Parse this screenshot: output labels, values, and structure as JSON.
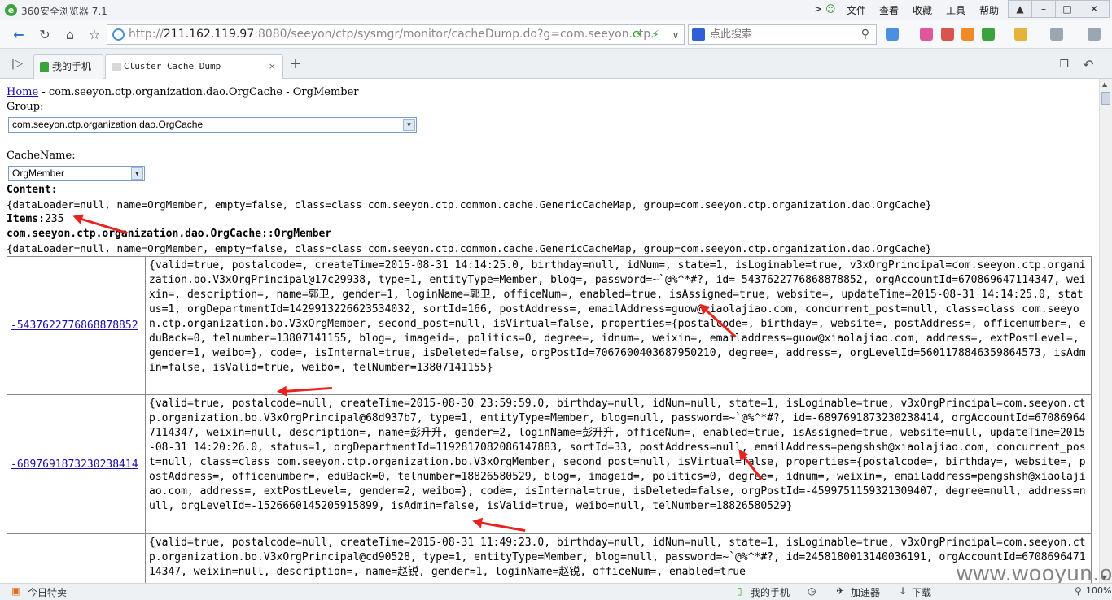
{
  "browser": {
    "title": "360安全浏览器 7.1",
    "menu": [
      "文件",
      "查看",
      "收藏",
      "工具",
      "帮助"
    ],
    "url_prefix": "http://",
    "url_host": "211.162.119.97",
    "url_rest": ":8080/seeyon/ctp/sysmgr/monitor/cacheDump.do?g=com.seeyon.ctp.",
    "search_placeholder": "点此搜索",
    "tabs": [
      {
        "label": "我的手机"
      },
      {
        "label": "Cluster Cache Dump",
        "active": true
      }
    ],
    "status_left": "今日特卖",
    "status_items": [
      "我的手机",
      "加速器",
      "下载",
      "100%"
    ]
  },
  "page": {
    "breadcrumb_home": "Home",
    "breadcrumb_rest": " - com.seeyon.ctp.organization.dao.OrgCache - OrgMember",
    "group_label": "Group:",
    "group_value": "com.seeyon.ctp.organization.dao.OrgCache",
    "cachename_label": "CacheName:",
    "cachename_value": "OrgMember",
    "content_label": "Content:",
    "content_desc": "{dataLoader=null, name=OrgMember, empty=false, class=class com.seeyon.ctp.common.cache.GenericCacheMap, group=com.seeyon.ctp.organization.dao.OrgCache}",
    "items_label": "Items:",
    "items_count": "235",
    "cache_heading": "com.seeyon.ctp.organization.dao.OrgCache::OrgMember",
    "cache_desc": "{dataLoader=null, name=OrgMember, empty=false, class=class com.seeyon.ctp.common.cache.GenericCacheMap, group=com.seeyon.ctp.organization.dao.OrgCache}",
    "rows": [
      {
        "key": "-5437622776868878852",
        "value": "{valid=true, postalcode=, createTime=2015-08-31 14:14:25.0, birthday=null, idNum=, state=1, isLoginable=true, v3xOrgPrincipal=com.seeyon.ctp.organization.bo.V3xOrgPrincipal@17c29938, type=1, entityType=Member, blog=, password=~`@%^*#?, id=-5437622776868878852, orgAccountId=670869647114347, weixin=, description=, name=郭卫, gender=1, loginName=郭卫, officeNum=, enabled=true, isAssigned=true, website=, updateTime=2015-08-31 14:14:25.0, status=1, orgDepartmentId=1429913226623534032, sortId=166, postAddress=, emailAddress=guow@xiaolajiao.com, concurrent_post=null, class=class com.seeyon.ctp.organization.bo.V3xOrgMember, second_post=null, isVirtual=false, properties={postalcode=, birthday=, website=, postAddress=, officenumber=, eduBack=0, telnumber=13807141155, blog=, imageid=, politics=0, degree=, idnum=, weixin=, emailaddress=guow@xiaolajiao.com, address=, extPostLevel=, gender=1, weibo=}, code=, isInternal=true, isDeleted=false, orgPostId=7067600403687950210, degree=, address=, orgLevelId=5601178846359864573, isAdmin=false, isValid=true, weibo=, telNumber=13807141155}"
      },
      {
        "key": "-6897691873230238414",
        "value": "{valid=true, postalcode=null, createTime=2015-08-30 23:59:59.0, birthday=null, idNum=null, state=1, isLoginable=true, v3xOrgPrincipal=com.seeyon.ctp.organization.bo.V3xOrgPrincipal@68d937b7, type=1, entityType=Member, blog=null, password=~`@%^*#?, id=-6897691873230238414, orgAccountId=670869647114347, weixin=null, description=, name=彭升升, gender=2, loginName=彭升升, officeNum=, enabled=true, isAssigned=true, website=null, updateTime=2015-08-31 14:20:26.0, status=1, orgDepartmentId=1192817082086147883, sortId=33, postAddress=null, emailAddress=pengshsh@xiaolajiao.com, concurrent_post=null, class=class com.seeyon.ctp.organization.bo.V3xOrgMember, second_post=null, isVirtual=false, properties={postalcode=, birthday=, website=, postAddress=, officenumber=, eduBack=0, telnumber=18826580529, blog=, imageid=, politics=0, degree=, idnum=, weixin=, emailaddress=pengshsh@xiaolajiao.com, address=, extPostLevel=, gender=2, weibo=}, code=, isInternal=true, isDeleted=false, orgPostId=-4599751159321309407, degree=null, address=null, orgLevelId=-1526660145205915899, isAdmin=false, isValid=true, weibo=null, telNumber=18826580529}"
      },
      {
        "key": "",
        "value": "{valid=true, postalcode=null, createTime=2015-08-31 11:49:23.0, birthday=null, idNum=null, state=1, isLoginable=true, v3xOrgPrincipal=com.seeyon.ctp.organization.bo.V3xOrgPrincipal@cd90528, type=1, entityType=Member, blog=null, password=~`@%^*#?, id=2458180013140036191, orgAccountId=670869647114347, weixin=null, description=, name=赵锐, gender=1, loginName=赵锐, officeNum=, enabled=true"
      }
    ]
  },
  "watermark": "www.wooyun.org",
  "colors": {
    "accent": "#e8231f",
    "link": "#1a0dab"
  }
}
